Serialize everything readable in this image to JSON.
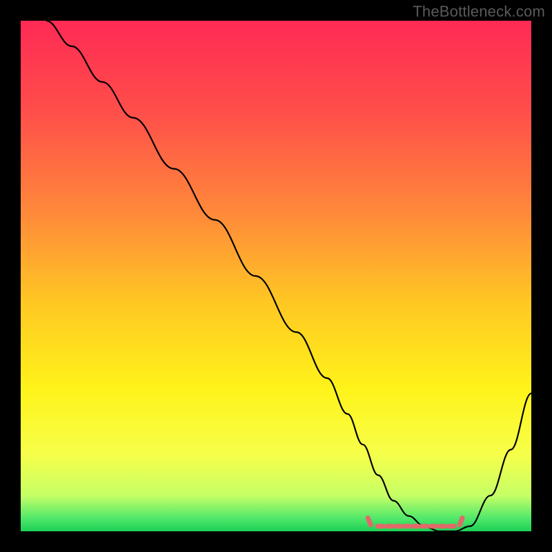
{
  "watermark": "TheBottleneck.com",
  "chart_data": {
    "type": "line",
    "title": "",
    "xlabel": "",
    "ylabel": "",
    "xlim": [
      0,
      100
    ],
    "ylim": [
      0,
      100
    ],
    "grid": false,
    "axes_visible": false,
    "background_gradient": {
      "type": "vertical",
      "stops": [
        {
          "offset": 0.0,
          "color": "#ff2a55"
        },
        {
          "offset": 0.18,
          "color": "#ff4f4a"
        },
        {
          "offset": 0.38,
          "color": "#ff8a3a"
        },
        {
          "offset": 0.55,
          "color": "#ffc723"
        },
        {
          "offset": 0.72,
          "color": "#fff31a"
        },
        {
          "offset": 0.85,
          "color": "#f6ff4a"
        },
        {
          "offset": 0.93,
          "color": "#c6ff66"
        },
        {
          "offset": 0.975,
          "color": "#4fe86a"
        },
        {
          "offset": 1.0,
          "color": "#1ccf55"
        }
      ]
    },
    "series": [
      {
        "name": "bottleneck-curve",
        "color": "#000000",
        "width": 2.2,
        "x": [
          5,
          10,
          16,
          22,
          30,
          38,
          46,
          54,
          60,
          64,
          67,
          70,
          73,
          76,
          79,
          82,
          85,
          88,
          92,
          96,
          100
        ],
        "y": [
          100,
          95,
          88,
          81,
          71,
          61,
          50,
          39,
          30,
          23,
          17,
          11,
          6,
          3,
          1,
          0,
          0,
          1,
          7,
          16,
          27
        ]
      }
    ],
    "highlight": {
      "name": "flat-green-range",
      "color": "#e06a6a",
      "width": 7,
      "xrange": [
        68,
        86.5
      ],
      "y": 1
    }
  }
}
